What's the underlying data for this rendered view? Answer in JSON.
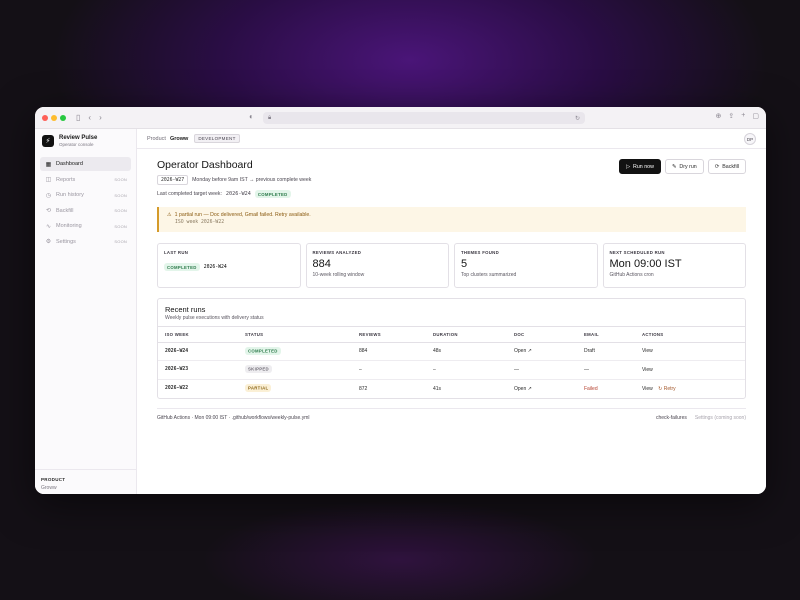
{
  "brand": {
    "title": "Review Pulse",
    "subtitle": "Operator console"
  },
  "sidebar": {
    "items": [
      {
        "label": "Dashboard",
        "icon": "dashboard-icon",
        "glyph": "▦",
        "soon": ""
      },
      {
        "label": "Reports",
        "icon": "reports-icon",
        "glyph": "◫",
        "soon": "SOON"
      },
      {
        "label": "Run history",
        "icon": "history-icon",
        "glyph": "◷",
        "soon": "SOON"
      },
      {
        "label": "Backfill",
        "icon": "backfill-icon",
        "glyph": "⟲",
        "soon": "SOON"
      },
      {
        "label": "Monitoring",
        "icon": "monitoring-icon",
        "glyph": "∿",
        "soon": "SOON"
      },
      {
        "label": "Settings",
        "icon": "settings-icon",
        "glyph": "⚙",
        "soon": "SOON"
      }
    ],
    "footer_title": "PRODUCT",
    "footer_value": "Groww"
  },
  "topbar": {
    "product_label": "Product",
    "product_name": "Groww",
    "env": "DEVELOPMENT",
    "avatar": "DP"
  },
  "header": {
    "title": "Operator Dashboard",
    "week": "2026-W27",
    "week_desc": "Monday before 9am IST → previous complete week",
    "last_label": "Last completed target week:",
    "last_week": "2026-W24",
    "last_status": "COMPLETED"
  },
  "buttons": {
    "run_now": "Run now",
    "dry_run": "Dry run",
    "backfill": "Backfill"
  },
  "alert": {
    "line1": "1 partial run — Doc delivered, Gmail failed. Retry available.",
    "line2": "ISO week 2026-W22"
  },
  "stats": {
    "last_run": {
      "label": "LAST RUN",
      "status": "COMPLETED",
      "week": "2026-W24"
    },
    "reviews": {
      "label": "REVIEWS ANALYZED",
      "value": "884",
      "sub": "10-week rolling window"
    },
    "themes": {
      "label": "THEMES FOUND",
      "value": "5",
      "sub": "Top clusters summarized"
    },
    "next": {
      "label": "NEXT SCHEDULED RUN",
      "value": "Mon 09:00 IST",
      "sub": "GitHub Actions cron"
    }
  },
  "runs": {
    "title": "Recent runs",
    "subtitle": "Weekly pulse executions with delivery status",
    "columns": [
      "ISO WEEK",
      "STATUS",
      "REVIEWS",
      "DURATION",
      "DOC",
      "EMAIL",
      "ACTIONS"
    ],
    "rows": [
      {
        "week": "2026-W24",
        "status": "COMPLETED",
        "reviews": "884",
        "duration": "48s",
        "doc": "Open ↗",
        "email": "Draft",
        "view": "View",
        "retry": ""
      },
      {
        "week": "2026-W23",
        "status": "SKIPPED",
        "reviews": "–",
        "duration": "–",
        "doc": "—",
        "email": "—",
        "view": "View",
        "retry": ""
      },
      {
        "week": "2026-W22",
        "status": "PARTIAL",
        "reviews": "872",
        "duration": "41s",
        "doc": "Open ↗",
        "email": "Failed",
        "view": "View",
        "retry": "↻ Retry"
      }
    ]
  },
  "footer": {
    "left": "GitHub Actions · Mon 09:00 IST · .github/workflows/weekly-pulse.yml",
    "check": "check-failures",
    "settings": "Settings (coming soon)"
  }
}
